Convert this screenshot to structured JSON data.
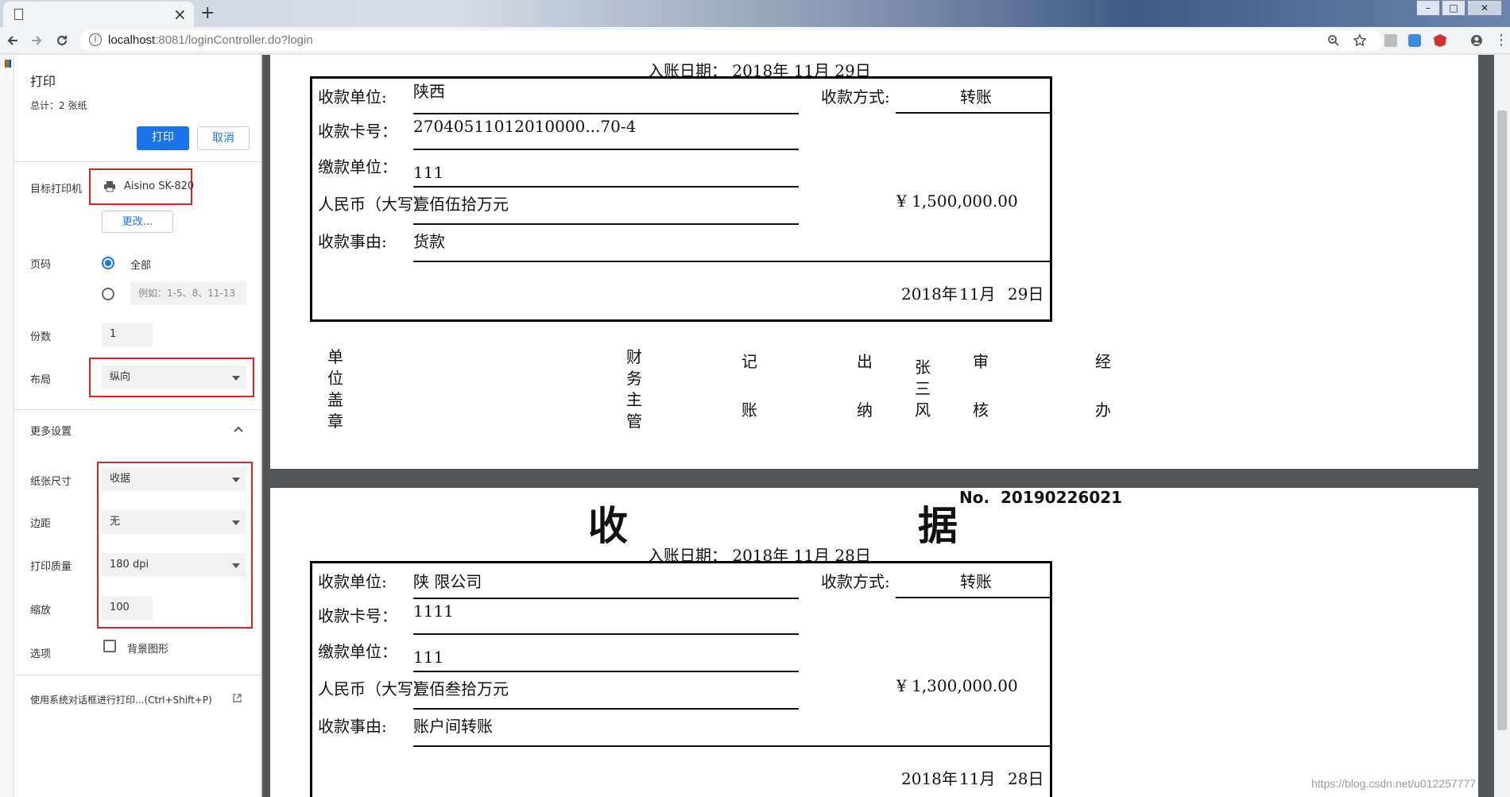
{
  "browser": {
    "tab_close": "×",
    "new_tab": "+",
    "url_host": "localhost",
    "url_rest": ":8081/loginController.do?login",
    "window_controls": [
      "–",
      "□",
      "✕"
    ]
  },
  "print_panel": {
    "title": "打印",
    "total": "总计：2 张纸",
    "print_button": "打印",
    "cancel_button": "取消",
    "destination_label": "目标打印机",
    "printer_name": "Aisino SK-820",
    "change_button": "更改...",
    "pages_label": "页码",
    "pages_all": "全部",
    "pages_placeholder": "例如：1-5、8、11-13",
    "copies_label": "份数",
    "copies_value": "1",
    "layout_label": "布局",
    "layout_value": "纵向",
    "more_settings": "更多设置",
    "paper_size_label": "纸张尺寸",
    "paper_size_value": "收据",
    "margins_label": "边距",
    "margins_value": "无",
    "quality_label": "打印质量",
    "quality_value": "180 dpi",
    "scale_label": "缩放",
    "scale_value": "100",
    "options_label": "选项",
    "background_graphics": "背景图形",
    "system_dialog": "使用系统对话框进行打印...(Ctrl+Shift+P)"
  },
  "receipt1": {
    "entry_date": "入账日期：  2018年     11月     29日",
    "payee_unit_label": "收款单位:",
    "payee_unit_value": "陕西",
    "pay_method_label": "收款方式:",
    "pay_method_value": "转账",
    "card_label": "收款卡号：",
    "card_value": "27040511012010000...70-4",
    "payer_label": "缴款单位：",
    "payer_value": "111",
    "rmb_label": "人民币（大写）",
    "rmb_value": "壹佰伍拾万元",
    "amount": "¥   1,500,000.00",
    "reason_label": "收款事由:",
    "reason_value": "货款",
    "date_year": "2018年",
    "date_month": "11月",
    "date_day": "29日"
  },
  "signatures": {
    "unit_seal": [
      "单",
      "位",
      "盖",
      "章"
    ],
    "finance": [
      "财",
      "务",
      "主",
      "管"
    ],
    "bookkeeping": [
      "记",
      "账"
    ],
    "cashier": [
      "出",
      "纳"
    ],
    "cashier_name": [
      "张",
      "三",
      "风"
    ],
    "review": [
      "审",
      "核"
    ],
    "handler": [
      "经",
      "办"
    ]
  },
  "receipt2": {
    "title_left": "收",
    "title_right": "据",
    "no_label": "No.",
    "no_value": "20190226021",
    "entry_date": "入账日期：  2018年     11月     28日",
    "payee_unit_label": "收款单位:",
    "payee_unit_value": "陕         限公司",
    "pay_method_label": "收款方式:",
    "pay_method_value": "转账",
    "card_label": "收款卡号：",
    "card_value": "1111",
    "payer_label": "缴款单位：",
    "payer_value": "111",
    "rmb_label": "人民币（大写）",
    "rmb_value": "壹佰叁拾万元",
    "amount": "¥   1,300,000.00",
    "reason_label": "收款事由:",
    "reason_value": "账户间转账",
    "date_year": "2018年",
    "date_month": "11月",
    "date_day": "28日"
  },
  "watermark": "https://blog.csdn.net/u012257777"
}
